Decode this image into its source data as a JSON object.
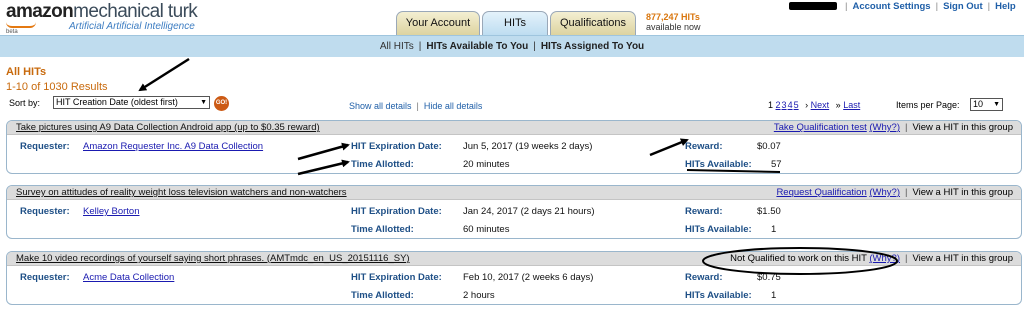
{
  "header": {
    "logo_line1": "amazonmechanical turk",
    "logo_beta": "beta",
    "logo_line2": "Artificial Artificial Intelligence",
    "tabs": [
      {
        "label": "Your Account"
      },
      {
        "label": "HITs"
      },
      {
        "label": "Qualifications"
      }
    ],
    "available_count": "877,247 HITs",
    "available_text": "available now",
    "links": [
      "Account Settings",
      "Sign Out",
      "Help"
    ]
  },
  "subnav": {
    "items": [
      "All HITs",
      "HITs Available To You",
      "HITs Assigned To You"
    ]
  },
  "listing": {
    "heading": "All HITs",
    "results": "1-10 of 1030 Results",
    "sort_label": "Sort by:",
    "sort_value": "HIT Creation Date (oldest first)",
    "go_label": "GO!",
    "show_details": "Show all details",
    "hide_details": "Hide all details",
    "pages": [
      "1",
      "2",
      "3",
      "4",
      "5"
    ],
    "next": "Next",
    "last": "Last",
    "ipp_label": "Items per Page:",
    "ipp_value": "10"
  },
  "labels": {
    "requester": "Requester:",
    "expiration": "HIT Expiration Date:",
    "time_allotted": "Time Allotted:",
    "reward": "Reward:",
    "hits_available": "HITs Available:",
    "why": "(Why?)",
    "view_group": "View a HIT in this group"
  },
  "hits": [
    {
      "title": "Take pictures using A9 Data Collection Android app (up to $0.35 reward)",
      "qual_action": "Take Qualification test",
      "requester": "Amazon Requester Inc. A9 Data Collection",
      "expiration": "Jun 5, 2017  (19 weeks 2 days)",
      "time_allotted": "20 minutes",
      "reward": "$0.07",
      "hits_available": "57"
    },
    {
      "title": "Survey on attitudes of reality weight loss television watchers and non-watchers",
      "qual_action": "Request Qualification",
      "requester": "Kelley Borton",
      "expiration": "Jan 24, 2017  (2 days 21 hours)",
      "time_allotted": "60 minutes",
      "reward": "$1.50",
      "hits_available": "1"
    },
    {
      "title": "Make 10 video recordings of yourself saying short phrases. (AMTmdc_en_US_20151116_SY)",
      "qual_action": "Not Qualified to work on this HIT",
      "requester": "Acme Data Collection",
      "expiration": "Feb 10, 2017  (2 weeks 6 days)",
      "time_allotted": "2 hours",
      "reward": "$0.75",
      "hits_available": "1"
    }
  ],
  "colors": {
    "accent_orange": "#c86a0d",
    "link_blue": "#1a1ab0",
    "label_blue": "#1e4f86",
    "subnav_bg": "#bfdcee"
  }
}
